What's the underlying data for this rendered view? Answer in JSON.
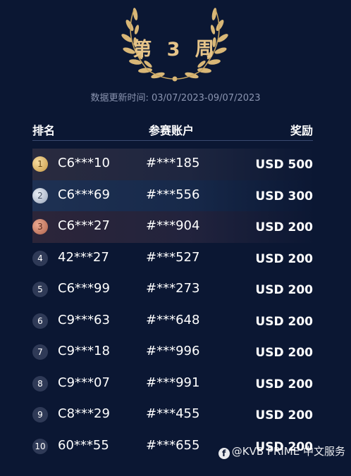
{
  "header": {
    "week_title": "第 3 周",
    "update_time": "数据更新时间: 03/07/2023-09/07/2023"
  },
  "table": {
    "columns": [
      "排名",
      "参赛账户",
      "奖励"
    ],
    "rows": [
      {
        "rank": "1",
        "user": "C6***10",
        "account": "#***185",
        "reward": "USD 500"
      },
      {
        "rank": "2",
        "user": "C6***69",
        "account": "#***556",
        "reward": "USD 300"
      },
      {
        "rank": "3",
        "user": "C6***27",
        "account": "#***904",
        "reward": "USD 200"
      },
      {
        "rank": "4",
        "user": "42***27",
        "account": "#***527",
        "reward": "USD 200"
      },
      {
        "rank": "5",
        "user": "C6***99",
        "account": "#***273",
        "reward": "USD 200"
      },
      {
        "rank": "6",
        "user": "C9***63",
        "account": "#***648",
        "reward": "USD 200"
      },
      {
        "rank": "7",
        "user": "C9***18",
        "account": "#***996",
        "reward": "USD 200"
      },
      {
        "rank": "8",
        "user": "C9***07",
        "account": "#***991",
        "reward": "USD 200"
      },
      {
        "rank": "9",
        "user": "C8***29",
        "account": "#***455",
        "reward": "USD 200"
      },
      {
        "rank": "10",
        "user": "60***55",
        "account": "#***655",
        "reward": "USD 200"
      }
    ]
  },
  "watermark": {
    "text": "@KVB PRIME 中文服务",
    "icon": "facebook-icon"
  },
  "colors": {
    "background": "#0b1733",
    "gold": "#e6c489",
    "muted": "#8b95b1"
  }
}
